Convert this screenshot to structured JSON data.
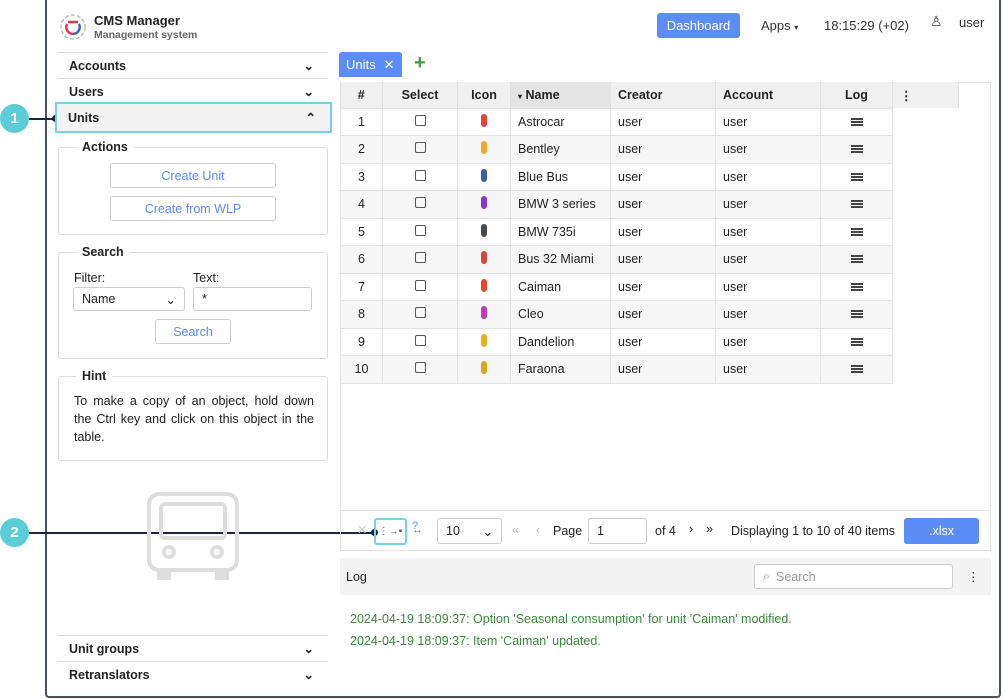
{
  "header": {
    "title": "CMS Manager",
    "subtitle": "Management system",
    "dashboard": "Dashboard",
    "apps": "Apps",
    "time": "18:15:29 (+02)",
    "user": "user"
  },
  "callouts": [
    "1",
    "2"
  ],
  "sidebar": {
    "accounts": "Accounts",
    "users": "Users",
    "units": "Units",
    "unit_groups": "Unit groups",
    "retranslators": "Retranslators",
    "actions": {
      "legend": "Actions",
      "create_unit": "Create Unit",
      "create_wlp": "Create from WLP"
    },
    "search": {
      "legend": "Search",
      "filter_label": "Filter:",
      "filter_value": "Name",
      "text_label": "Text:",
      "text_value": "*",
      "button": "Search"
    },
    "hint": {
      "legend": "Hint",
      "text": "To make a copy of an object, hold down the Ctrl key and click on this object in the table."
    }
  },
  "tabs": [
    {
      "label": "Units"
    }
  ],
  "table": {
    "columns": [
      "#",
      "Select",
      "Icon",
      "Name",
      "Creator",
      "Account",
      "Log"
    ],
    "rows": [
      {
        "n": "1",
        "name": "Astrocar",
        "creator": "user",
        "account": "user",
        "color": "#e0443a"
      },
      {
        "n": "2",
        "name": "Bentley",
        "creator": "user",
        "account": "user",
        "color": "#f0a82a"
      },
      {
        "n": "3",
        "name": "Blue Bus",
        "creator": "user",
        "account": "user",
        "color": "#3a5ea8"
      },
      {
        "n": "4",
        "name": "BMW 3 series",
        "creator": "user",
        "account": "user",
        "color": "#8a3ac8"
      },
      {
        "n": "5",
        "name": "BMW 735i",
        "creator": "user",
        "account": "user",
        "color": "#444a55"
      },
      {
        "n": "6",
        "name": "Bus 32 Miami",
        "creator": "user",
        "account": "user",
        "color": "#d0483a"
      },
      {
        "n": "7",
        "name": "Caiman",
        "creator": "user",
        "account": "user",
        "color": "#e04a2a"
      },
      {
        "n": "8",
        "name": "Cleo",
        "creator": "user",
        "account": "user",
        "color": "#c03ab0"
      },
      {
        "n": "9",
        "name": "Dandelion",
        "creator": "user",
        "account": "user",
        "color": "#e8b020"
      },
      {
        "n": "10",
        "name": "Faraona",
        "creator": "user",
        "account": "user",
        "color": "#d8a818"
      }
    ]
  },
  "pager": {
    "per_page": "10",
    "page_label": "Page",
    "page": "1",
    "of": "of 4",
    "display": "Displaying 1 to 10 of 40 items",
    "export": ".xlsx"
  },
  "log": {
    "title": "Log",
    "search_placeholder": "Search",
    "entries": [
      "2024-04-19 18:09:37: Option 'Seasonal consumption' for unit 'Caiman' modified.",
      "2024-04-19 18:09:37: Item 'Caiman' updated."
    ]
  }
}
